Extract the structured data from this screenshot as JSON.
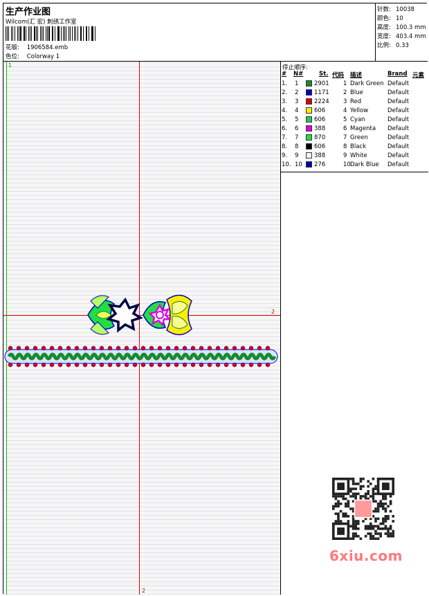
{
  "header": {
    "title": "生产作业图",
    "company": "Wilcom(汇 宏) 刺绣工作室",
    "design_label": "花版:",
    "design_value": "1906584.emb",
    "colorway_label": "色位:",
    "colorway_value": "Colorway 1"
  },
  "stats": {
    "stitches_label": "针数:",
    "stitches_value": "10038",
    "colors_label": "颜色:",
    "colors_value": "10",
    "height_label": "高度:",
    "height_value": "100.3 mm",
    "width_label": "宽度:",
    "width_value": "403.4 mm",
    "scale_label": "比例:",
    "scale_value": "0.33"
  },
  "design": {
    "mark_top_left": "1",
    "mark_h": "2",
    "mark_v": "2"
  },
  "stop_sequence": {
    "title": "停止顺序:",
    "columns": [
      "#",
      "N#",
      "St.",
      "代码",
      "描述",
      "Brand",
      "元素"
    ],
    "rows": [
      {
        "idx": "1.",
        "n": "1",
        "color": "#1a8a2a",
        "st": "2901",
        "code": "1",
        "desc": "Dark Green",
        "brand": "Default"
      },
      {
        "idx": "2.",
        "n": "2",
        "color": "#0000cc",
        "st": "1171",
        "code": "2",
        "desc": "Blue",
        "brand": "Default"
      },
      {
        "idx": "3.",
        "n": "3",
        "color": "#e00000",
        "st": "2224",
        "code": "3",
        "desc": "Red",
        "brand": "Default"
      },
      {
        "idx": "4.",
        "n": "4",
        "color": "#ffee00",
        "st": "606",
        "code": "4",
        "desc": "Yellow",
        "brand": "Default"
      },
      {
        "idx": "5.",
        "n": "5",
        "color": "#22cc55",
        "st": "606",
        "code": "5",
        "desc": "Cyan",
        "brand": "Default"
      },
      {
        "idx": "6.",
        "n": "6",
        "color": "#e000e0",
        "st": "388",
        "code": "6",
        "desc": "Magenta",
        "brand": "Default"
      },
      {
        "idx": "7.",
        "n": "7",
        "color": "#22dd44",
        "st": "870",
        "code": "7",
        "desc": "Green",
        "brand": "Default"
      },
      {
        "idx": "8.",
        "n": "8",
        "color": "#000000",
        "st": "606",
        "code": "8",
        "desc": "Black",
        "brand": "Default"
      },
      {
        "idx": "9.",
        "n": "9",
        "color": "#f4f4f4",
        "st": "388",
        "code": "9",
        "desc": "White",
        "brand": "Default"
      },
      {
        "idx": "10.",
        "n": "10",
        "color": "#0000aa",
        "st": "276",
        "code": "10",
        "desc": "Dark Blue",
        "brand": "Default"
      }
    ]
  },
  "watermark": {
    "text": "6xiu.com",
    "color": "#ff7a7a"
  }
}
